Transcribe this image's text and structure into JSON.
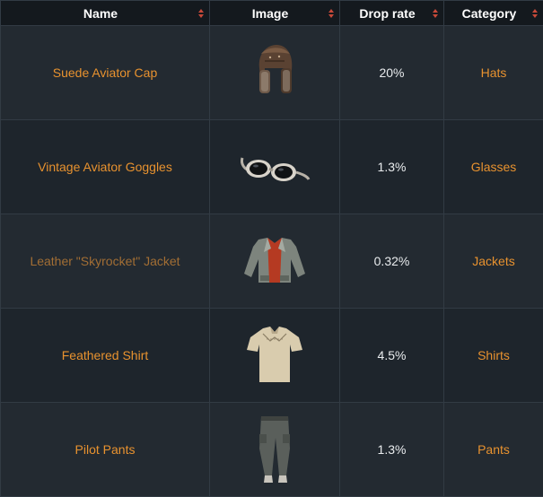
{
  "table": {
    "headers": [
      {
        "label": "Name"
      },
      {
        "label": "Image"
      },
      {
        "label": "Drop rate"
      },
      {
        "label": "Category"
      }
    ],
    "rows": [
      {
        "name": "Suede Aviator Cap",
        "image_icon": "aviator-cap-icon",
        "drop_rate": "20%",
        "category": "Hats",
        "visited": false
      },
      {
        "name": "Vintage Aviator Goggles",
        "image_icon": "goggles-icon",
        "drop_rate": "1.3%",
        "category": "Glasses",
        "visited": false
      },
      {
        "name": "Leather \"Skyrocket\" Jacket",
        "image_icon": "jacket-icon",
        "drop_rate": "0.32%",
        "category": "Jackets",
        "visited": true
      },
      {
        "name": "Feathered Shirt",
        "image_icon": "shirt-icon",
        "drop_rate": "4.5%",
        "category": "Shirts",
        "visited": false
      },
      {
        "name": "Pilot Pants",
        "image_icon": "pants-icon",
        "drop_rate": "1.3%",
        "category": "Pants",
        "visited": false
      }
    ]
  },
  "colors": {
    "link": "#e8922f",
    "link_visited": "#a26e34",
    "header_bg": "#14191e",
    "row_bg": "#232a31",
    "sort_arrow": "#c94a3a"
  }
}
